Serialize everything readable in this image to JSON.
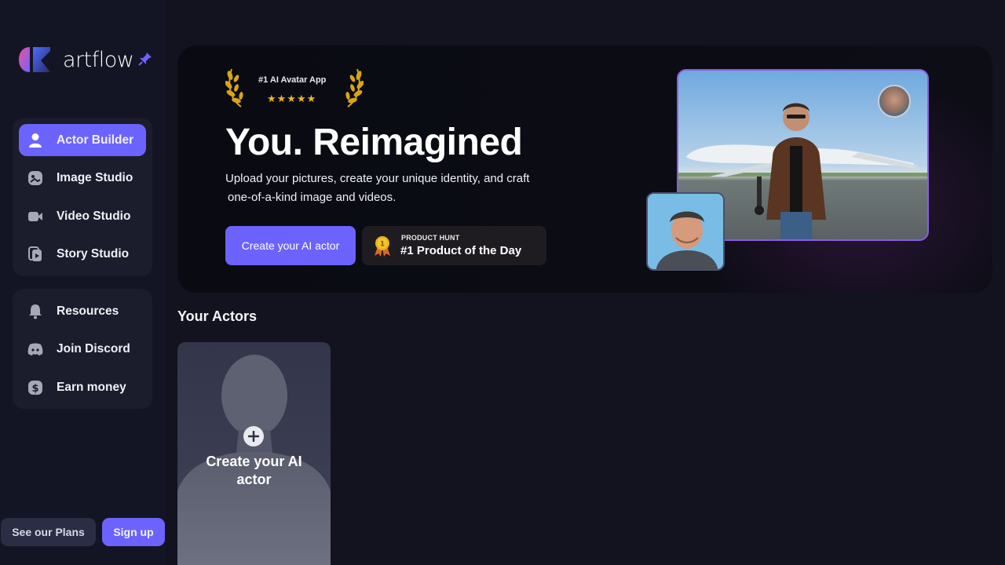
{
  "brand": {
    "name": "artflow",
    "accent": "#6c63ff"
  },
  "sidebar": {
    "primary": [
      {
        "label": "Actor Builder",
        "icon": "user-icon",
        "active": true
      },
      {
        "label": "Image Studio",
        "icon": "image-studio-icon",
        "active": false
      },
      {
        "label": "Video Studio",
        "icon": "video-camera-icon",
        "active": false
      },
      {
        "label": "Story Studio",
        "icon": "story-icon",
        "active": false
      }
    ],
    "secondary": [
      {
        "label": "Resources",
        "icon": "bell-icon"
      },
      {
        "label": "Join Discord",
        "icon": "discord-icon"
      },
      {
        "label": "Earn money",
        "icon": "dollar-coin-icon"
      }
    ],
    "plans_label": "See our Plans",
    "signup_label": "Sign up"
  },
  "hero": {
    "award_title": "#1 AI Avatar App",
    "award_stars": "★★★★★",
    "title": "You. Reimagined",
    "subtitle_line1": "Upload your pictures, create your unique identity, and craft",
    "subtitle_line2": "one-of-a-kind image and videos.",
    "cta_label": "Create your AI actor",
    "product_hunt": {
      "small": "PRODUCT HUNT",
      "big": "#1 Product of the Day",
      "medal_number": "1"
    }
  },
  "actors": {
    "section_title": "Your Actors",
    "create_label": "Create your AI actor"
  }
}
